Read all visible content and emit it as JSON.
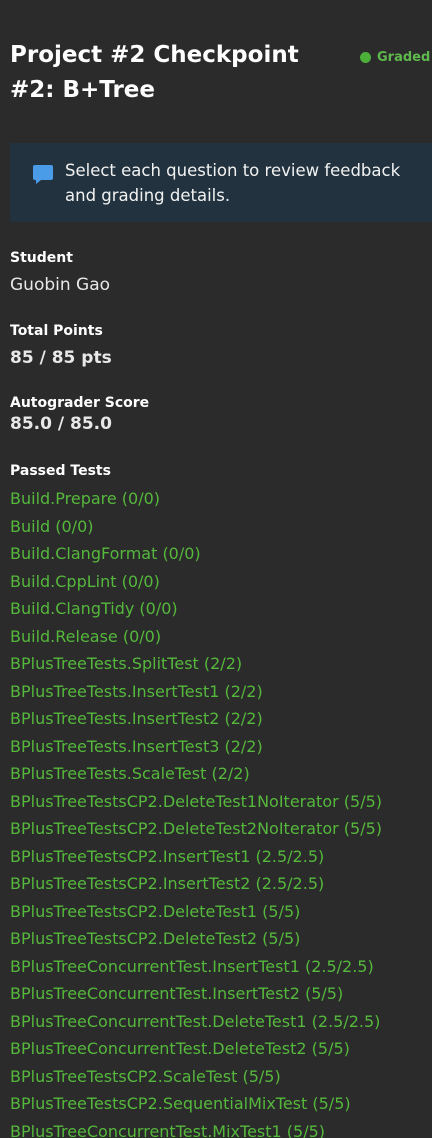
{
  "header": {
    "title": "Project #2 Checkpoint #2: B+Tree",
    "status": "Graded"
  },
  "banner": {
    "text": "Select each question to review feedback and grading details."
  },
  "student": {
    "label": "Student",
    "value": "Guobin Gao"
  },
  "total_points": {
    "label": "Total Points",
    "value": "85 / 85 pts"
  },
  "autograder": {
    "label": "Autograder Score",
    "value": "85.0 / 85.0"
  },
  "passed_tests": {
    "label": "Passed Tests",
    "items": [
      "Build.Prepare (0/0)",
      "Build (0/0)",
      "Build.ClangFormat (0/0)",
      "Build.CppLint (0/0)",
      "Build.ClangTidy (0/0)",
      "Build.Release (0/0)",
      "BPlusTreeTests.SplitTest (2/2)",
      "BPlusTreeTests.InsertTest1 (2/2)",
      "BPlusTreeTests.InsertTest2 (2/2)",
      "BPlusTreeTests.InsertTest3 (2/2)",
      "BPlusTreeTests.ScaleTest (2/2)",
      "BPlusTreeTestsCP2.DeleteTest1NoIterator (5/5)",
      "BPlusTreeTestsCP2.DeleteTest2NoIterator (5/5)",
      "BPlusTreeTestsCP2.InsertTest1 (2.5/2.5)",
      "BPlusTreeTestsCP2.InsertTest2 (2.5/2.5)",
      "BPlusTreeTestsCP2.DeleteTest1 (5/5)",
      "BPlusTreeTestsCP2.DeleteTest2 (5/5)",
      "BPlusTreeConcurrentTest.InsertTest1 (2.5/2.5)",
      "BPlusTreeConcurrentTest.InsertTest2 (5/5)",
      "BPlusTreeConcurrentTest.DeleteTest1 (2.5/2.5)",
      "BPlusTreeConcurrentTest.DeleteTest2 (5/5)",
      "BPlusTreeTestsCP2.ScaleTest (5/5)",
      "BPlusTreeTestsCP2.SequentialMixTest (5/5)",
      "BPlusTreeConcurrentTest.MixTest1 (5/5)"
    ]
  },
  "colors": {
    "background": "#2b2b2b",
    "banner": "#22333f",
    "accent_green": "#55b83c",
    "banner_icon": "#4a9ce8"
  },
  "icons": {
    "status": "status-dot-icon",
    "banner": "speech-bubble-icon"
  }
}
